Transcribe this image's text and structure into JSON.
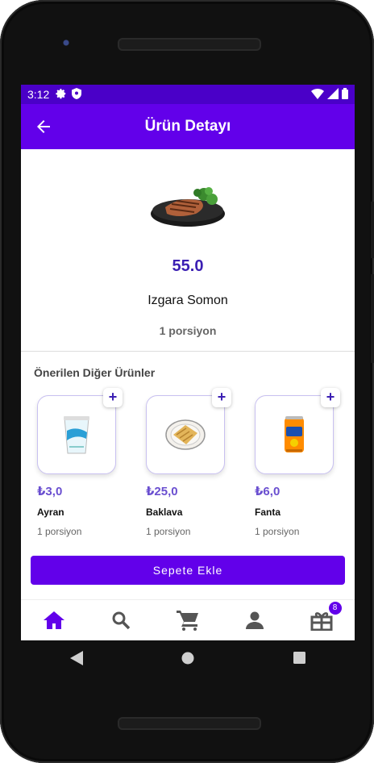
{
  "status": {
    "time": "3:12"
  },
  "appbar": {
    "title": "Ürün Detayı"
  },
  "product": {
    "price": "55.0",
    "name": "Izgara Somon",
    "portion": "1 porsiyon"
  },
  "recommended": {
    "title": "Önerilen Diğer Ürünler",
    "items": [
      {
        "price": "₺3,0",
        "name": "Ayran",
        "portion": "1 porsiyon"
      },
      {
        "price": "₺25,0",
        "name": "Baklava",
        "portion": "1 porsiyon"
      },
      {
        "price": "₺6,0",
        "name": "Fanta",
        "portion": "1 porsiyon"
      }
    ]
  },
  "actions": {
    "add_to_cart": "Sepete Ekle"
  },
  "nav": {
    "badge_count": "8",
    "active_color": "#6200ea",
    "icon_color": "#555555"
  }
}
